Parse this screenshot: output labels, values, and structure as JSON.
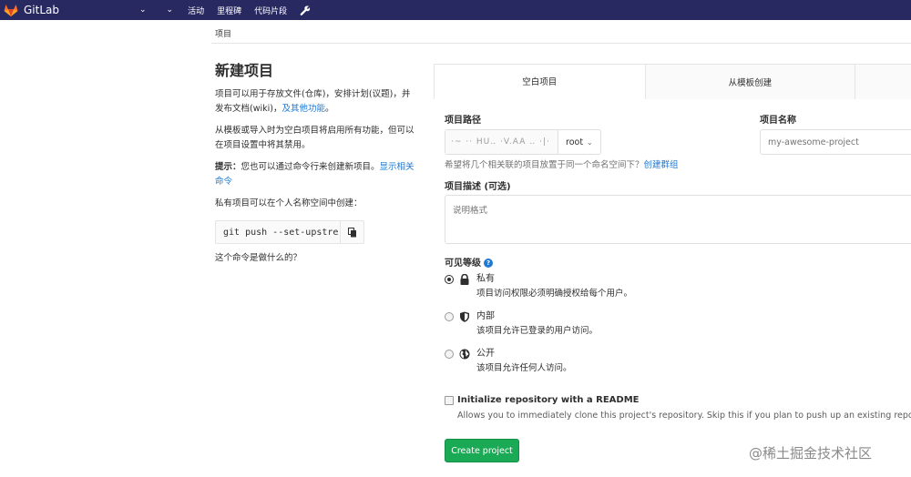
{
  "navbar": {
    "brand": "GitLab",
    "items": [
      "活动",
      "里程碑",
      "代码片段"
    ],
    "chevron": "⌄"
  },
  "breadcrumb": "项目",
  "left": {
    "title": "新建项目",
    "desc1": "项目可以用于存放文件(仓库)，安排计划(议题)，并发布文档(wiki)，",
    "desc1_link": "及其他功能",
    "desc1_end": "。",
    "desc2": "从模板或导入时为空白项目将启用所有功能，但可以在项目设置中将其禁用。",
    "tip_prefix": "提示：",
    "tip": "您也可以通过命令行来创建新项目。",
    "tip_link": "显示相关命令",
    "private_note": "私有项目可以在个人名称空间中创建：",
    "command": "git push --set-upstre",
    "cmd_help": "这个命令是做什么的？"
  },
  "tabs": [
    "空白项目",
    "从模板创建",
    ""
  ],
  "form": {
    "path_label": "项目路径",
    "path_prefix": "·~ ·· HU‥ ·V.AA ‥ ·|·",
    "namespace": "root",
    "name_label": "项目名称",
    "name_placeholder": "my-awesome-project",
    "ns_help": "希望将几个相关联的项目放置于同一个命名空间下？",
    "ns_help_link": "创建群组",
    "desc_label": "项目描述 (可选)",
    "desc_placeholder": "说明格式",
    "visibility_label": "可见等级",
    "visibility": [
      {
        "title": "私有",
        "desc": "项目访问权限必须明确授权给每个用户。",
        "icon": "lock-icon",
        "checked": true
      },
      {
        "title": "内部",
        "desc": "该项目允许已登录的用户访问。",
        "icon": "shield-icon",
        "checked": false
      },
      {
        "title": "公开",
        "desc": "该项目允许任何人访问。",
        "icon": "globe-icon",
        "checked": false
      }
    ],
    "readme_label": "Initialize repository with a README",
    "readme_help": "Allows you to immediately clone this project's repository. Skip this if you plan to push up an existing repository.",
    "create_button": "Create project"
  },
  "watermark": "@稀土掘金技术社区",
  "colors": {
    "navbar": "#292961",
    "link": "#1f78d1",
    "create": "#1aaa55"
  }
}
